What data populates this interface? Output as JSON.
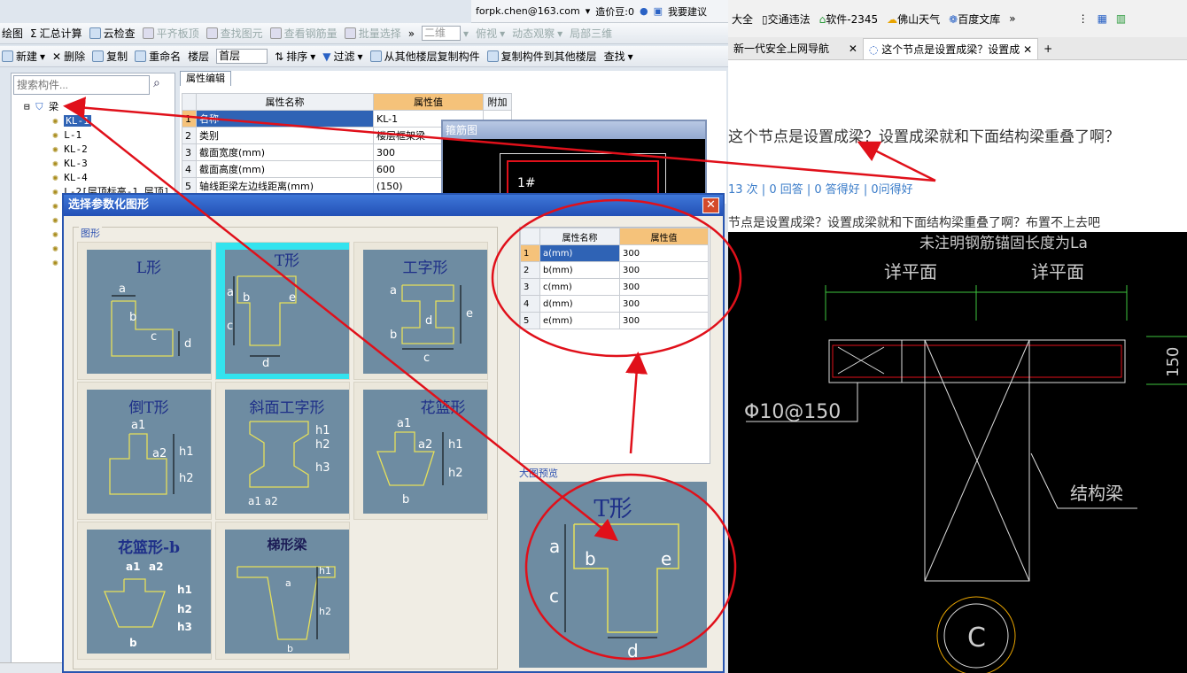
{
  "toolbar_top": {
    "email": "forpk.chen@163.com",
    "coins": "造价豆:0",
    "feedback": "我要建议"
  },
  "toolbar1": {
    "items": [
      "绘图",
      "汇总计算",
      "云检查",
      "平齐板顶",
      "查找图元",
      "查看钢筋量",
      "批量选择",
      "二维",
      "俯视",
      "动态观察",
      "局部三维"
    ]
  },
  "toolbar2": {
    "items": [
      "新建",
      "删除",
      "复制",
      "重命名",
      "楼层",
      "首层",
      "排序",
      "过滤",
      "从其他楼层复制构件",
      "复制构件到其他楼层",
      "查找"
    ]
  },
  "left_panel": {
    "search_placeholder": "搜索构件...",
    "root": "梁",
    "items": [
      "KL-1",
      "L-1",
      "KL-2",
      "KL-3",
      "KL-4",
      "L-2[层顶标高-1,层顶]"
    ],
    "selected": "KL-1"
  },
  "prop_editor": {
    "tab": "属性编辑",
    "headers": [
      "属性名称",
      "属性值",
      "附加"
    ],
    "rows": [
      {
        "n": "1",
        "name": "名称",
        "value": "KL-1"
      },
      {
        "n": "2",
        "name": "类别",
        "value": "楼层框架梁"
      },
      {
        "n": "3",
        "name": "截面宽度(mm)",
        "value": "300"
      },
      {
        "n": "4",
        "name": "截面高度(mm)",
        "value": "600"
      },
      {
        "n": "5",
        "name": "轴线距梁左边线距离(mm)",
        "value": "(150)"
      }
    ]
  },
  "rebar_window": {
    "title": "箍筋图",
    "label": "1#"
  },
  "dialog": {
    "title": "选择参数化图形",
    "group_label": "图形",
    "shapes": [
      "L形",
      "T形",
      "工字形",
      "倒T形",
      "斜面工字形",
      "花篮形",
      "花篮形-b",
      "梯形梁"
    ],
    "selected_shape": "T形",
    "param_headers": [
      "属性名称",
      "属性值"
    ],
    "params": [
      {
        "n": "1",
        "name": "a(mm)",
        "value": "300"
      },
      {
        "n": "2",
        "name": "b(mm)",
        "value": "300"
      },
      {
        "n": "3",
        "name": "c(mm)",
        "value": "300"
      },
      {
        "n": "4",
        "name": "d(mm)",
        "value": "300"
      },
      {
        "n": "5",
        "name": "e(mm)",
        "value": "300"
      }
    ],
    "preview_label": "大图预览",
    "preview_title": "T形"
  },
  "browser": {
    "bookmarks": [
      "大全",
      "交通违法",
      "软件-2345",
      "佛山天气",
      "百度文库"
    ],
    "tabs": [
      "新一代安全上网导航",
      "这个节点是设置成梁？设置成"
    ],
    "question": "这个节点是设置成梁？设置成梁就和下面结构梁重叠了啊？",
    "stats": "13 次 | 0 回答 | 0 答得好 | 0问得好",
    "desc": "节点是设置成梁？设置成梁就和下面结构梁重叠了啊？布置不上去吧",
    "cad_texts": [
      "未注明钢筋锚固长度为La",
      "详平面",
      "详平面",
      "Φ10@150",
      "结构梁",
      "150",
      "C"
    ]
  },
  "colors": {
    "annotation": "#e0101a",
    "selected_shape_bg": "#33e3ee",
    "shape_bg": "#6e8ca2",
    "dialog_title": "#2350b6",
    "value_header": "#f5c27a"
  }
}
